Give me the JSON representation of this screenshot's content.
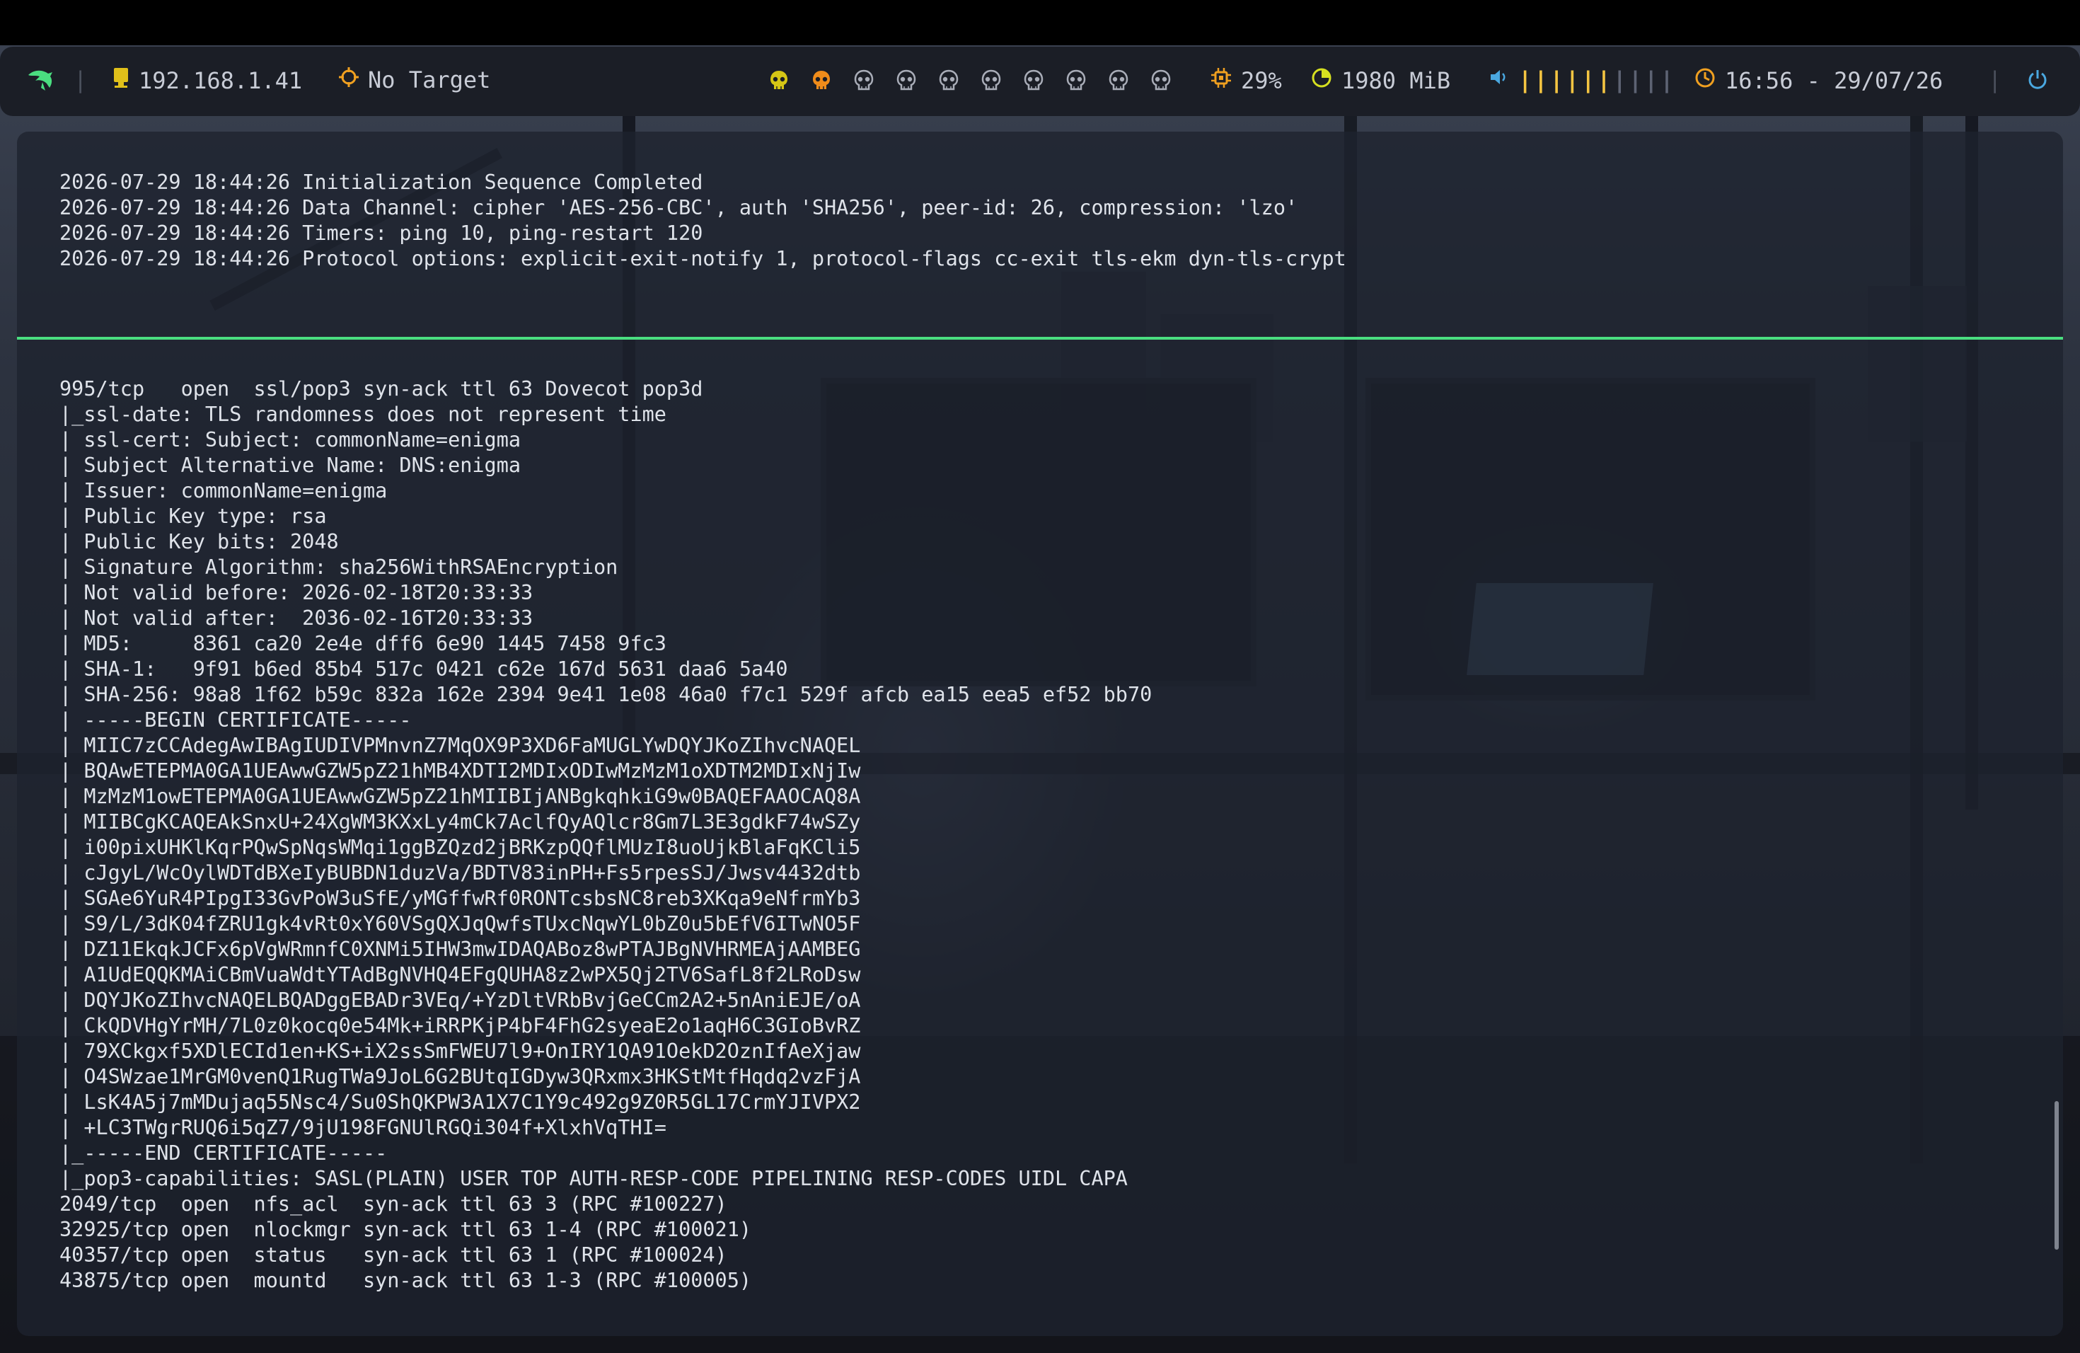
{
  "topbar": {
    "logo_icon": "dragon-icon",
    "ip_address": "192.168.1.41",
    "target": "No Target",
    "cpu": "29%",
    "memory": "1980 MiB",
    "volume_level_fraction": 0.6,
    "clock": "16:56 - 29/07/26",
    "colors": {
      "green": "#4ade80",
      "accent_yellow": "#e0c01a",
      "accent_orange": "#f0a020",
      "blue": "#4aa8e0"
    },
    "workspaces": [
      {
        "icon": "skull-icon",
        "state": "active",
        "color": "#d6c615"
      },
      {
        "icon": "skull-icon",
        "state": "occupied",
        "color": "#f08c1a"
      },
      {
        "icon": "skull-icon",
        "state": "empty",
        "color": "#a9adb8"
      },
      {
        "icon": "skull-icon",
        "state": "empty",
        "color": "#a9adb8"
      },
      {
        "icon": "skull-icon",
        "state": "empty",
        "color": "#a9adb8"
      },
      {
        "icon": "skull-icon",
        "state": "empty",
        "color": "#a9adb8"
      },
      {
        "icon": "skull-icon",
        "state": "empty",
        "color": "#a9adb8"
      },
      {
        "icon": "skull-icon",
        "state": "empty",
        "color": "#a9adb8"
      },
      {
        "icon": "skull-icon",
        "state": "empty",
        "color": "#a9adb8"
      },
      {
        "icon": "skull-icon",
        "state": "empty",
        "color": "#a9adb8"
      }
    ]
  },
  "terminal_top": {
    "lines": [
      "2026-07-29 18:44:26 Initialization Sequence Completed",
      "2026-07-29 18:44:26 Data Channel: cipher 'AES-256-CBC', auth 'SHA256', peer-id: 26, compression: 'lzo'",
      "2026-07-29 18:44:26 Timers: ping 10, ping-restart 120",
      "2026-07-29 18:44:26 Protocol options: explicit-exit-notify 1, protocol-flags cc-exit tls-ekm dyn-tls-crypt"
    ]
  },
  "terminal_bottom": {
    "lines": [
      "995/tcp   open  ssl/pop3 syn-ack ttl 63 Dovecot pop3d",
      "|_ssl-date: TLS randomness does not represent time",
      "| ssl-cert: Subject: commonName=enigma",
      "| Subject Alternative Name: DNS:enigma",
      "| Issuer: commonName=enigma",
      "| Public Key type: rsa",
      "| Public Key bits: 2048",
      "| Signature Algorithm: sha256WithRSAEncryption",
      "| Not valid before: 2026-02-18T20:33:33",
      "| Not valid after:  2036-02-16T20:33:33",
      "| MD5:     8361 ca20 2e4e dff6 6e90 1445 7458 9fc3",
      "| SHA-1:   9f91 b6ed 85b4 517c 0421 c62e 167d 5631 daa6 5a40",
      "| SHA-256: 98a8 1f62 b59c 832a 162e 2394 9e41 1e08 46a0 f7c1 529f afcb ea15 eea5 ef52 bb70",
      "| -----BEGIN CERTIFICATE-----",
      "| MIIC7zCCAdegAwIBAgIUDIVPMnvnZ7MqOX9P3XD6FaMUGLYwDQYJKoZIhvcNAQEL",
      "| BQAwETEPMA0GA1UEAwwGZW5pZ21hMB4XDTI2MDIxODIwMzMzM1oXDTM2MDIxNjIw",
      "| MzMzM1owETEPMA0GA1UEAwwGZW5pZ21hMIIBIjANBgkqhkiG9w0BAQEFAAOCAQ8A",
      "| MIIBCgKCAQEAkSnxU+24XgWM3KXxLy4mCk7AclfQyAQlcr8Gm7L3E3gdkF74wSZy",
      "| i00pixUHKlKqrPQwSpNqsWMqi1ggBZQzd2jBRKzpQQflMUzI8uoUjkBlaFqKCli5",
      "| cJgyL/WcOylWDTdBXeIyBUBDN1duzVa/BDTV83inPH+Fs5rpesSJ/Jwsv4432dtb",
      "| SGAe6YuR4PIpgI33GvPoW3uSfE/yMGffwRf0RONTcsbsNC8reb3XKqa9eNfrmYb3",
      "| S9/L/3dK04fZRU1gk4vRt0xY60VSgQXJqQwfsTUxcNqwYL0bZ0u5bEfV6ITwNO5F",
      "| DZ11EkqkJCFx6pVgWRmnfC0XNMi5IHW3mwIDAQABoz8wPTAJBgNVHRMEAjAAMBEG",
      "| A1UdEQQKMAiCBmVuaWdtYTAdBgNVHQ4EFgQUHA8z2wPX5Qj2TV6SafL8f2LRoDsw",
      "| DQYJKoZIhvcNAQELBQADggEBADr3VEq/+YzDltVRbBvjGeCCm2A2+5nAniEJE/oA",
      "| CkQDVHgYrMH/7L0z0kocq0e54Mk+iRRPKjP4bF4FhG2syeaE2o1aqH6C3GIoBvRZ",
      "| 79XCkgxf5XDlECId1en+KS+iX2ssSmFWEU7l9+OnIRY1QA91OekD2OznIfAeXjaw",
      "| O4SWzae1MrGM0venQ1RugTWa9JoL6G2BUtqIGDyw3QRxmx3HKStMtfHqdq2vzFjA",
      "| LsK4A5j7mMDujaq55Nsc4/Su0ShQKPW3A1X7C1Y9c492g9Z0R5GL17CrmYJIVPX2",
      "| +LC3TWgrRUQ6i5qZ7/9jU198FGNUlRGQi304f+XlxhVqTHI=",
      "|_-----END CERTIFICATE-----",
      "|_pop3-capabilities: SASL(PLAIN) USER TOP AUTH-RESP-CODE PIPELINING RESP-CODES UIDL CAPA",
      "2049/tcp  open  nfs_acl  syn-ack ttl 63 3 (RPC #100227)",
      "32925/tcp open  nlockmgr syn-ack ttl 63 1-4 (RPC #100021)",
      "40357/tcp open  status   syn-ack ttl 63 1 (RPC #100024)",
      "43875/tcp open  mountd   syn-ack ttl 63 1-3 (RPC #100005)"
    ]
  }
}
